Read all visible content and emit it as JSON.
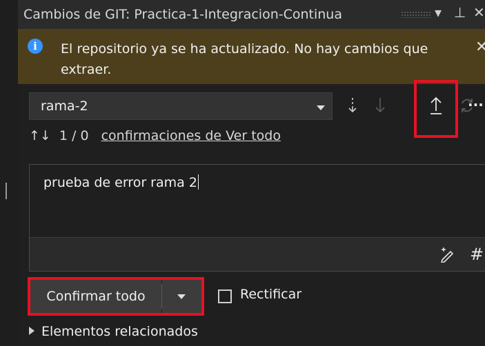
{
  "window": {
    "title": "Cambios de GIT: Practica-1-Integracion-Continua",
    "pin_glyph": "⊥",
    "close_glyph": "✕",
    "dropdown_glyph": "▾"
  },
  "infobar": {
    "icon": "info-icon",
    "message": "El repositorio ya se ha actualizado. No hay cambios que extraer.",
    "close_glyph": "✕"
  },
  "branch": {
    "selected": "rama-2"
  },
  "toolbar": {
    "fetch_icon": "fetch-icon",
    "pull_icon": "pull-icon",
    "push_icon": "push-icon",
    "sync_icon": "sync-icon",
    "more_glyph": "···"
  },
  "commits": {
    "arrows_glyph": "↑↓",
    "counts": "1 / 0",
    "link": "confirmaciones de Ver todo"
  },
  "message": {
    "text": "prueba de error rama 2",
    "tool_glyph": "#"
  },
  "actions": {
    "commit_label": "Confirmar todo",
    "amend_label": "Rectificar",
    "amend_checked": false
  },
  "related": {
    "label": "Elementos relacionados"
  },
  "colors": {
    "accent_info": "#3794ff",
    "highlight_red": "#e81123",
    "infobar_bg": "#4d3f1c"
  }
}
